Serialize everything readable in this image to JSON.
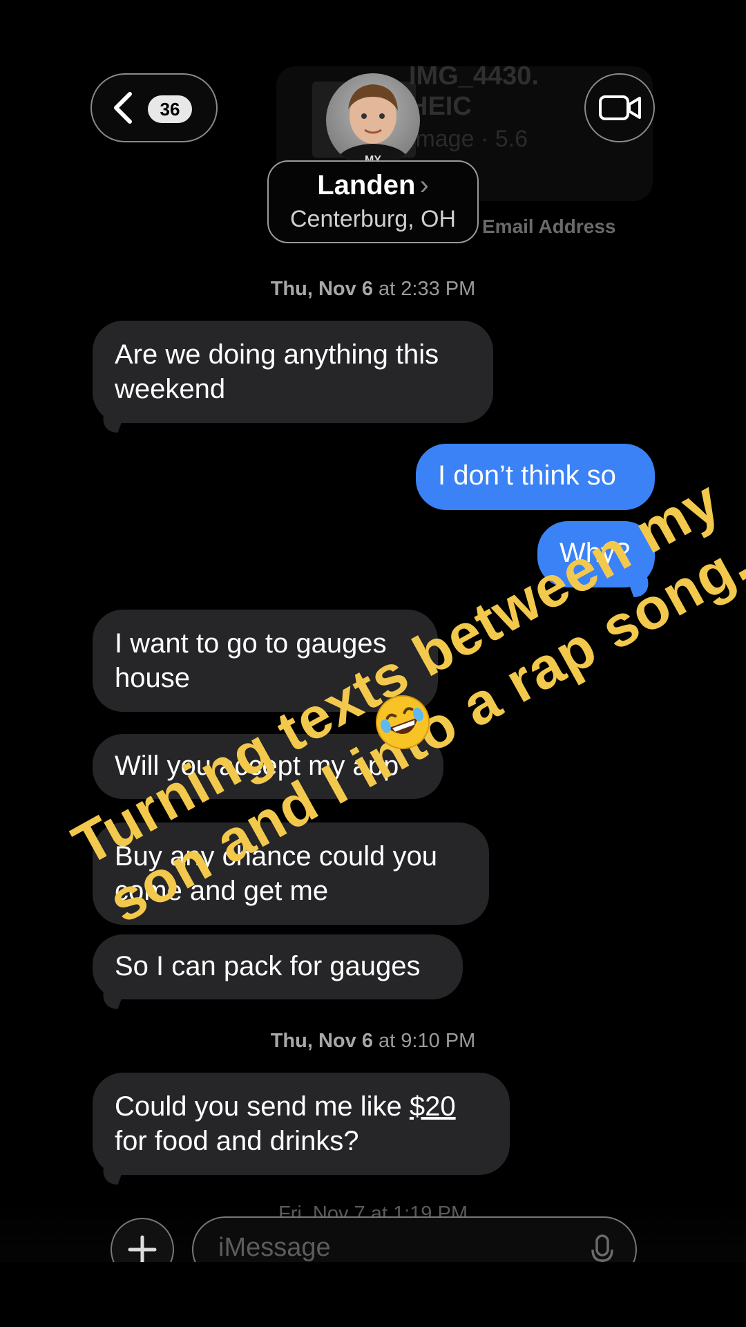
{
  "attachment": {
    "filename": "IMG_4430.\nHEIC",
    "meta": "Image · 5.6"
  },
  "email_label": "Email Address",
  "header": {
    "back_count": "36",
    "contact_name": "Landen",
    "contact_location": "Centerburg, OH",
    "avatar_shirt_text": "MY"
  },
  "messages": [
    {
      "type": "timestamp",
      "day": "Thu, Nov 6",
      "time": "at 2:33 PM"
    },
    {
      "type": "incoming",
      "text": "Are we doing anything this weekend"
    },
    {
      "type": "outgoing",
      "text": "I don’t think so"
    },
    {
      "type": "outgoing",
      "text": "Why?"
    },
    {
      "type": "incoming",
      "text": "I want to go to gauges house"
    },
    {
      "type": "incoming",
      "text": "Will you accept my app"
    },
    {
      "type": "incoming",
      "text": "Buy any chance could you come and get me"
    },
    {
      "type": "incoming",
      "text": "So I can pack for gauges"
    },
    {
      "type": "timestamp",
      "day": "Thu, Nov 6",
      "time": "at 9:10 PM"
    },
    {
      "type": "incoming",
      "text_before": "Could you send me like ",
      "amount": "$20",
      "text_after": "for food and drinks?"
    },
    {
      "type": "timestamp",
      "day": "Fri, Nov 7",
      "time": "at 1:19 PM"
    }
  ],
  "overlay": {
    "line1": "Turning texts between my",
    "line2": "son and I into a rap song.",
    "emoji": "rolling-on-floor-laughing-emoji",
    "color": "#f2c94c"
  },
  "composer": {
    "placeholder": "iMessage"
  },
  "colors": {
    "outgoing_bubble": "#3b82f6",
    "incoming_bubble": "#262628"
  }
}
